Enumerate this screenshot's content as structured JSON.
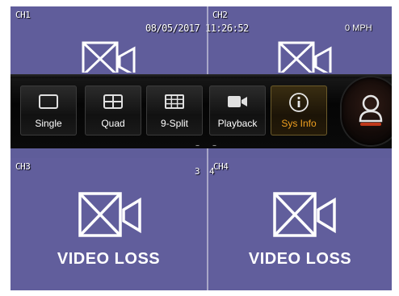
{
  "osd": {
    "datetime": "08/05/2017 11:26:52",
    "speed": "0 MPH"
  },
  "channels": [
    {
      "label": "CH1",
      "status": ""
    },
    {
      "label": "CH2",
      "status": ""
    },
    {
      "label": "CH3",
      "status": "VIDEO LOSS",
      "number": "3"
    },
    {
      "label": "CH4",
      "status": "VIDEO LOSS",
      "number": "4"
    }
  ],
  "menu": {
    "buttons": [
      {
        "label": "Single",
        "icon": "single-view-icon"
      },
      {
        "label": "Quad",
        "icon": "quad-view-icon"
      },
      {
        "label": "9-Split",
        "icon": "nine-split-icon"
      },
      {
        "label": "Playback",
        "icon": "video-camera-icon"
      },
      {
        "label": "Sys Info",
        "icon": "info-icon",
        "active": true
      }
    ],
    "user_icon": "user-icon"
  },
  "colors": {
    "background": "#5f5d9a",
    "menu_bg": "#0a0a0a",
    "active_label": "#f0a020",
    "user_accent": "#c0391b"
  }
}
